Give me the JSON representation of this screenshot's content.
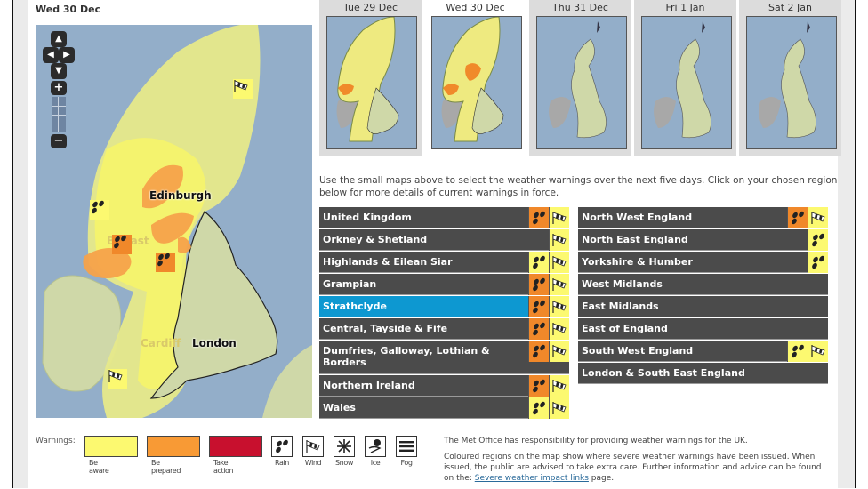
{
  "colors": {
    "be_aware": "#fcf970",
    "be_prepared": "#f89a35",
    "take_action": "#c8102e",
    "region_bg": "#4b4b4b",
    "region_selected": "#0d98d1",
    "sea": "#93aec9",
    "land": "#cfd8a8"
  },
  "main_map": {
    "title": "Wed 30 Dec",
    "labels": {
      "edinburgh": "Edinburgh",
      "belfast": "Belfast",
      "cardiff": "Cardiff",
      "london": "London"
    },
    "nav": {
      "up": "▲",
      "down": "▼",
      "left": "◀",
      "right": "▶",
      "zoom_in": "+",
      "zoom_out": "−"
    },
    "markers": [
      {
        "type": "wind",
        "level": "yellow"
      },
      {
        "type": "rain",
        "level": "yellow"
      },
      {
        "type": "rain",
        "level": "orange"
      },
      {
        "type": "rain",
        "level": "orange"
      },
      {
        "type": "wind",
        "level": "yellow"
      }
    ]
  },
  "days": [
    {
      "label": "Tue 29 Dec",
      "active": false,
      "has_warnings": true
    },
    {
      "label": "Wed 30 Dec",
      "active": true,
      "has_warnings": true
    },
    {
      "label": "Thu 31 Dec",
      "active": false,
      "has_warnings": false
    },
    {
      "label": "Fri 1 Jan",
      "active": false,
      "has_warnings": false
    },
    {
      "label": "Sat 2 Jan",
      "active": false,
      "has_warnings": false
    }
  ],
  "instructions": "Use the small maps above to select the weather warnings over the next five days. Click on your chosen region below for more details of current warnings in force.",
  "regions_left": [
    {
      "name": "United Kingdom",
      "selected": false,
      "warnings": [
        {
          "type": "rain",
          "level": "orange"
        },
        {
          "type": "wind",
          "level": "yellow"
        }
      ]
    },
    {
      "name": "Orkney & Shetland",
      "selected": false,
      "warnings": [
        {
          "type": "wind",
          "level": "yellow"
        }
      ]
    },
    {
      "name": "Highlands & Eilean Siar",
      "selected": false,
      "warnings": [
        {
          "type": "rain",
          "level": "yellow"
        },
        {
          "type": "wind",
          "level": "yellow"
        }
      ]
    },
    {
      "name": "Grampian",
      "selected": false,
      "warnings": [
        {
          "type": "rain",
          "level": "orange"
        },
        {
          "type": "wind",
          "level": "yellow"
        }
      ]
    },
    {
      "name": "Strathclyde",
      "selected": true,
      "warnings": [
        {
          "type": "rain",
          "level": "orange"
        },
        {
          "type": "wind",
          "level": "yellow"
        }
      ]
    },
    {
      "name": "Central, Tayside & Fife",
      "selected": false,
      "warnings": [
        {
          "type": "rain",
          "level": "orange"
        },
        {
          "type": "wind",
          "level": "yellow"
        }
      ]
    },
    {
      "name": "Dumfries, Galloway, Lothian & Borders",
      "selected": false,
      "warnings": [
        {
          "type": "rain",
          "level": "orange"
        },
        {
          "type": "wind",
          "level": "yellow"
        }
      ]
    },
    {
      "name": "Northern Ireland",
      "selected": false,
      "warnings": [
        {
          "type": "rain",
          "level": "orange"
        },
        {
          "type": "wind",
          "level": "yellow"
        }
      ]
    },
    {
      "name": "Wales",
      "selected": false,
      "warnings": [
        {
          "type": "rain",
          "level": "yellow"
        },
        {
          "type": "wind",
          "level": "yellow"
        }
      ]
    }
  ],
  "regions_right": [
    {
      "name": "North West England",
      "selected": false,
      "warnings": [
        {
          "type": "rain",
          "level": "orange"
        },
        {
          "type": "wind",
          "level": "yellow"
        }
      ]
    },
    {
      "name": "North East England",
      "selected": false,
      "warnings": [
        {
          "type": "rain",
          "level": "yellow"
        }
      ]
    },
    {
      "name": "Yorkshire & Humber",
      "selected": false,
      "warnings": [
        {
          "type": "rain",
          "level": "yellow"
        }
      ]
    },
    {
      "name": "West Midlands",
      "selected": false,
      "warnings": []
    },
    {
      "name": "East Midlands",
      "selected": false,
      "warnings": []
    },
    {
      "name": "East of England",
      "selected": false,
      "warnings": []
    },
    {
      "name": "South West England",
      "selected": false,
      "warnings": [
        {
          "type": "rain",
          "level": "yellow"
        },
        {
          "type": "wind",
          "level": "yellow"
        }
      ]
    },
    {
      "name": "London & South East England",
      "selected": false,
      "warnings": []
    }
  ],
  "legend": {
    "title": "Warnings:",
    "levels": [
      {
        "label": "Be aware",
        "color": "#fcf970"
      },
      {
        "label": "Be prepared",
        "color": "#f89a35"
      },
      {
        "label": "Take action",
        "color": "#c8102e"
      }
    ],
    "types": [
      {
        "label": "Rain",
        "icon": "rain"
      },
      {
        "label": "Wind",
        "icon": "wind"
      },
      {
        "label": "Snow",
        "icon": "snow"
      },
      {
        "label": "Ice",
        "icon": "ice"
      },
      {
        "label": "Fog",
        "icon": "fog"
      }
    ]
  },
  "footer": {
    "para1": "The Met Office has responsibility for providing weather warnings for the UK.",
    "para2_prefix": "Coloured regions on the map show where severe weather warnings have been issued. When issued, the public are advised to take extra care. Further information and advice can be found on the: ",
    "link_text": "Severe weather impact links",
    "para2_suffix": " page."
  }
}
